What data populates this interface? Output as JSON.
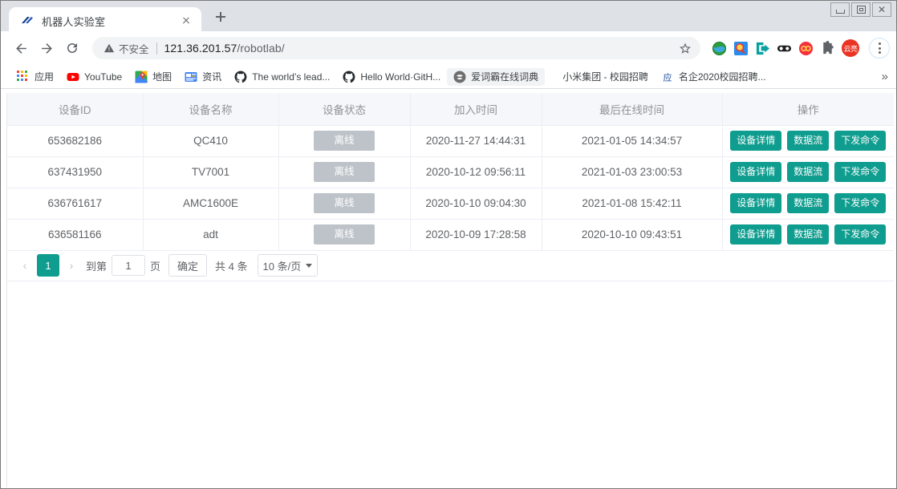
{
  "window": {
    "minimize_label": "minimize",
    "maximize_label": "maximize",
    "close_label": "close"
  },
  "tab": {
    "title": "机器人实验室",
    "favicon_name": "robotlab-favicon"
  },
  "toolbar": {
    "back_label": "←",
    "forward_label": "→",
    "reload_label": "⟳",
    "security_text": "不安全",
    "url_host": "121.36.201.57",
    "url_path": "/robotlab/",
    "avatar_label": "云亮"
  },
  "bookmarks": {
    "items": [
      {
        "label": "应用",
        "icon": "apps-grid-icon",
        "highlighted": false
      },
      {
        "label": "YouTube",
        "icon": "youtube-icon",
        "highlighted": false
      },
      {
        "label": "地图",
        "icon": "maps-icon",
        "highlighted": false
      },
      {
        "label": "资讯",
        "icon": "news-icon",
        "highlighted": false
      },
      {
        "label": "The world’s lead...",
        "icon": "github-icon",
        "highlighted": false
      },
      {
        "label": "Hello World·GitH...",
        "icon": "github-icon",
        "highlighted": false
      },
      {
        "label": "爱词霸在线词典",
        "icon": "iciba-icon",
        "highlighted": true
      },
      {
        "label": "小米集团 - 校园招聘",
        "icon": "none",
        "highlighted": false
      },
      {
        "label": "名企2020校园招聘...",
        "icon": "yingjiesheng-icon",
        "highlighted": false
      }
    ],
    "overflow_label": "»"
  },
  "table": {
    "columns": [
      "设备ID",
      "设备名称",
      "设备状态",
      "加入时间",
      "最后在线时间",
      "操作"
    ],
    "rows": [
      {
        "id": "653682186",
        "name": "QC410",
        "status": "离线",
        "join_time": "2020-11-27 14:44:31",
        "last_online": "2021-01-05 14:34:57"
      },
      {
        "id": "637431950",
        "name": "TV7001",
        "status": "离线",
        "join_time": "2020-10-12 09:56:11",
        "last_online": "2021-01-03 23:00:53"
      },
      {
        "id": "636761617",
        "name": "AMC1600E",
        "status": "离线",
        "join_time": "2020-10-10 09:04:30",
        "last_online": "2021-01-08 15:42:11"
      },
      {
        "id": "636581166",
        "name": "adt",
        "status": "离线",
        "join_time": "2020-10-09 17:28:58",
        "last_online": "2020-10-10 09:43:51"
      }
    ],
    "actions": {
      "detail": "设备详情",
      "datastream": "数据流",
      "command": "下发命令"
    }
  },
  "pagination": {
    "prev": "‹",
    "next": "›",
    "current_page": "1",
    "jump_prefix": "到第",
    "jump_value": "1",
    "jump_suffix": "页",
    "confirm": "确定",
    "total_text": "共 4 条",
    "page_size": "10 条/页"
  },
  "colors": {
    "accent_teal": "#0f9d8f",
    "status_gray": "#bdc3c9",
    "header_bg": "#f5f7fa",
    "avatar_red": "#ea3323"
  }
}
